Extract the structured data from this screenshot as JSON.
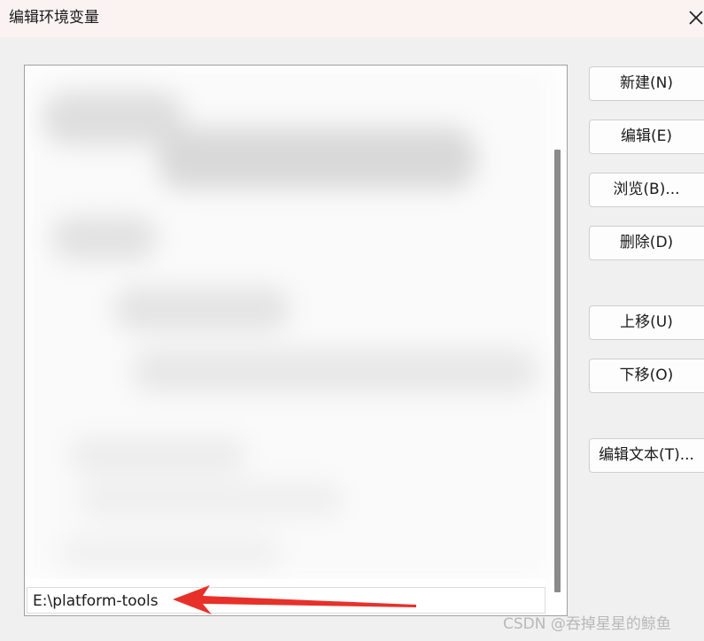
{
  "window": {
    "title": "编辑环境变量",
    "close_icon": "close-icon"
  },
  "list": {
    "selected_item": "E:\\platform-tools",
    "other_items_obscured": true
  },
  "buttons": {
    "new": "新建(N)",
    "edit": "编辑(E)",
    "browse": "浏览(B)...",
    "delete": "删除(D)",
    "move_up": "上移(U)",
    "move_down": "下移(O)",
    "edit_text": "编辑文本(T)..."
  },
  "annotation": {
    "arrow_color": "#e8302a",
    "arrow_icon": "red-arrow-icon"
  },
  "watermark": "CSDN @吞掉星星的鲸鱼"
}
